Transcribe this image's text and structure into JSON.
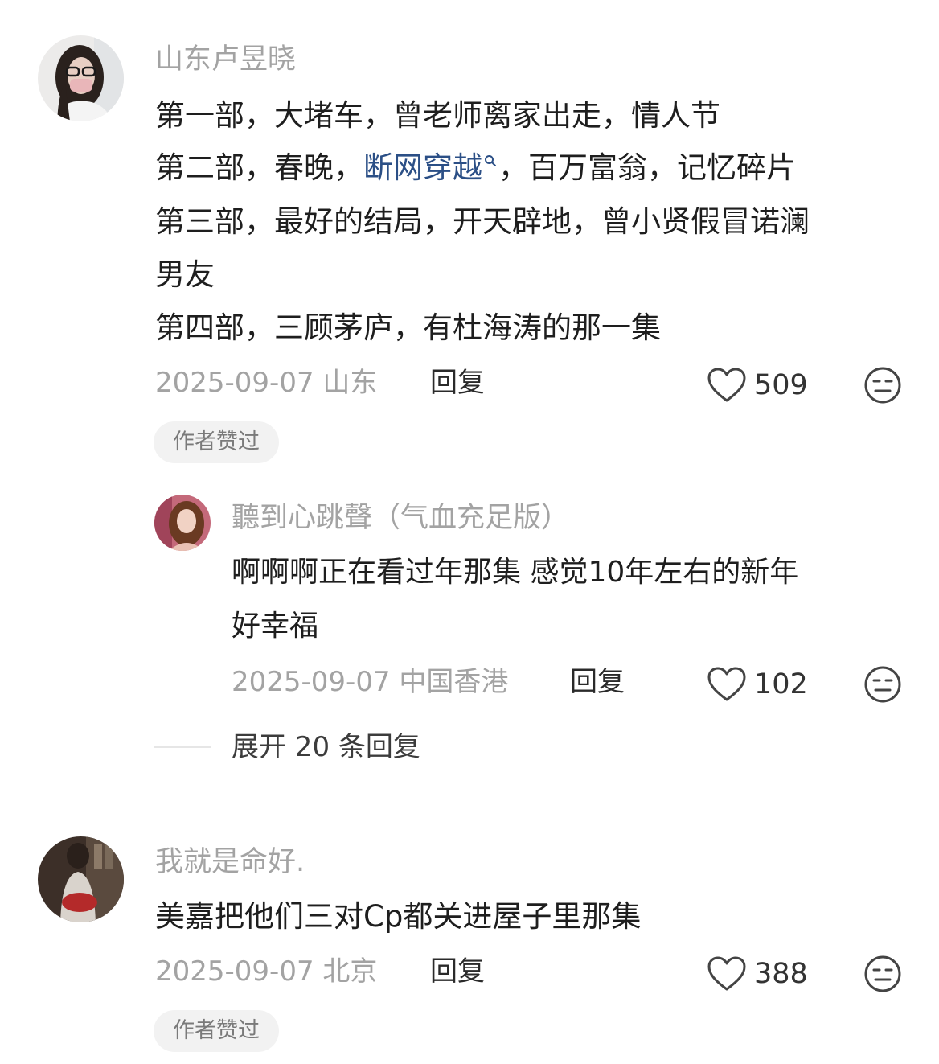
{
  "comments": [
    {
      "username": "山东卢昱晓",
      "lines": [
        {
          "text": "第一部，大堵车，曾老师离家出走，情人节"
        },
        {
          "before": "第二部，春晚，",
          "link": "断网穿越",
          "after": "，百万富翁，记忆碎片"
        },
        {
          "text": "第三部，最好的结局，开天辟地，曾小贤假冒诺澜"
        },
        {
          "text": "男友"
        },
        {
          "text": "第四部，三顾茅庐，有杜海涛的那一集"
        }
      ],
      "date": "2025-09-07",
      "location": "山东",
      "reply_label": "回复",
      "likes": "509",
      "author_tag": "作者赞过",
      "replies": [
        {
          "username": "聽到心跳聲（气血充足版）",
          "lines": [
            "啊啊啊正在看过年那集 感觉10年左右的新年",
            "好幸福"
          ],
          "date": "2025-09-07",
          "location": "中国香港",
          "reply_label": "回复",
          "likes": "102"
        }
      ],
      "expand_label": "展开 20 条回复"
    },
    {
      "username": "我就是命好.",
      "lines": [
        {
          "text": "美嘉把他们三对Cp都关进屋子里那集"
        }
      ],
      "date": "2025-09-07",
      "location": "北京",
      "reply_label": "回复",
      "likes": "388",
      "author_tag": "作者赞过"
    }
  ],
  "colors": {
    "muted_text": "#a3a3a3",
    "body_text": "#1e1e1e",
    "link": "#2b4f86",
    "tag_bg": "#f2f2f2"
  },
  "icons": {
    "like": "heart-outline-icon",
    "dislike": "meh-face-icon",
    "search": "search-icon"
  }
}
